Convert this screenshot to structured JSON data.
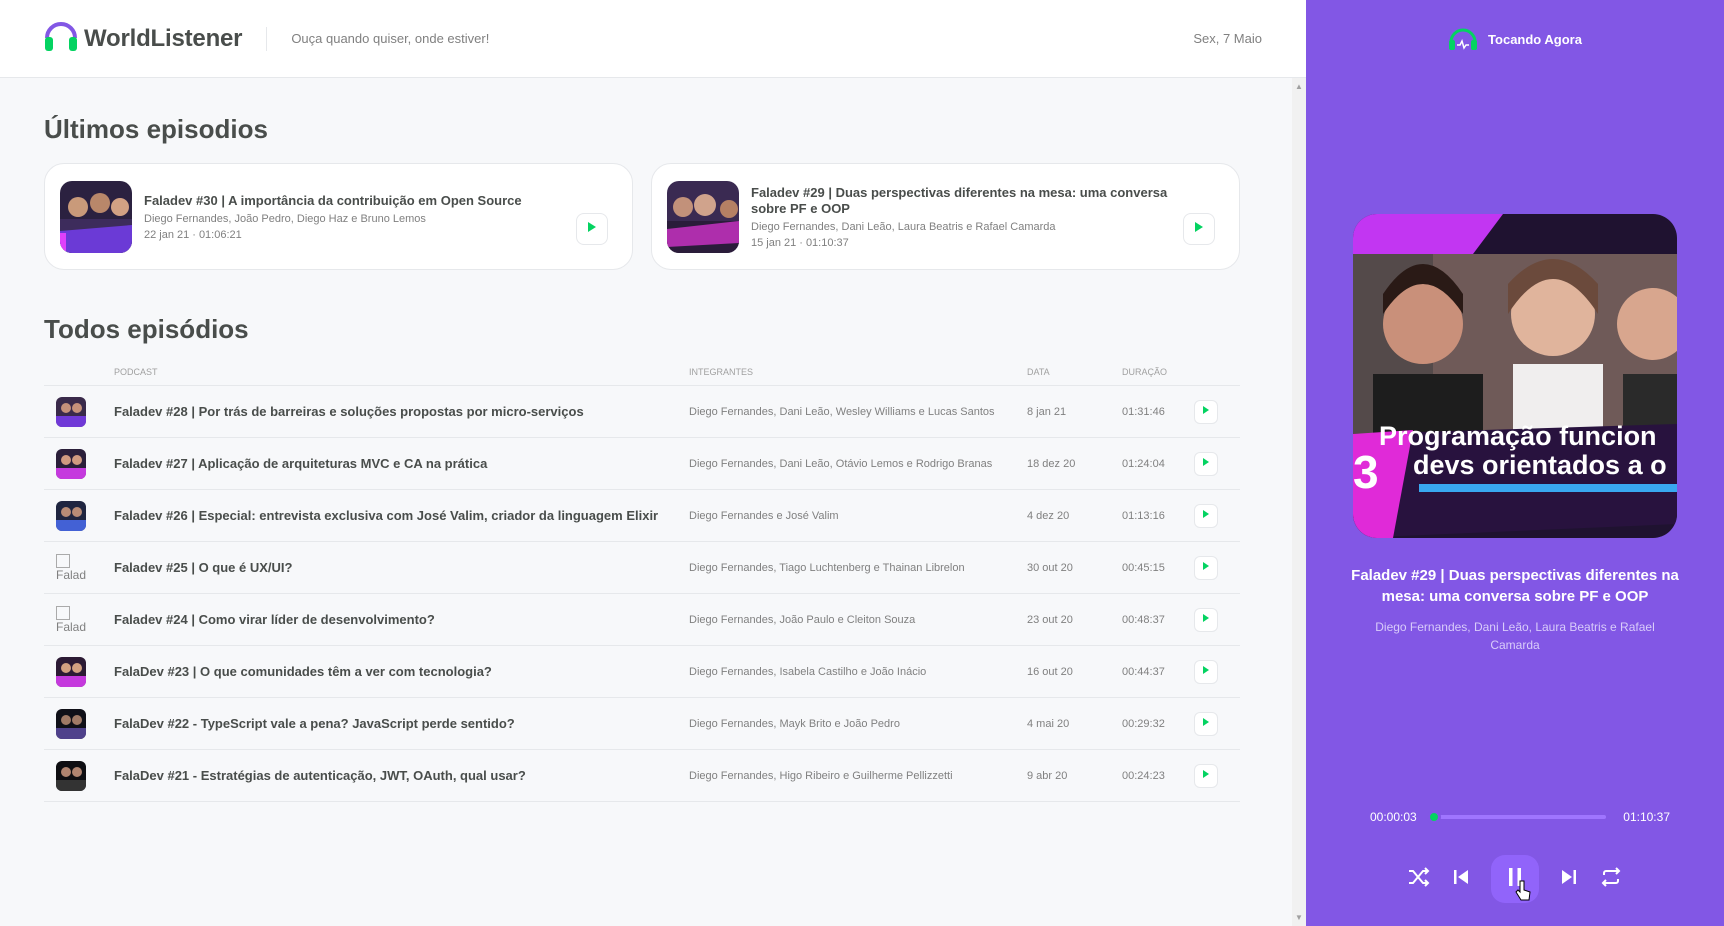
{
  "header": {
    "logo_text": "WorldListener",
    "tagline": "Ouça quando quiser, onde estiver!",
    "date": "Sex, 7 Maio"
  },
  "latest": {
    "title": "Últimos episodios",
    "items": [
      {
        "title": "Faladev #30 | A importância da contribuição em Open Source",
        "members": "Diego Fernandes, João Pedro, Diego Haz e Bruno Lemos",
        "date": "22 jan 21",
        "duration": "01:06:21"
      },
      {
        "title": "Faladev #29 | Duas perspectivas diferentes na mesa: uma conversa sobre PF e OOP",
        "members": "Diego Fernandes, Dani Leão, Laura Beatris e Rafael Camarda",
        "date": "15 jan 21",
        "duration": "01:10:37"
      }
    ]
  },
  "all": {
    "title": "Todos episódios",
    "columns": [
      "",
      "Podcast",
      "Integrantes",
      "Data",
      "Duração",
      ""
    ],
    "rows": [
      {
        "title": "Faladev #28 | Por trás de barreiras e soluções propostas por micro-serviços",
        "members": "Diego Fernandes, Dani Leão, Wesley Williams e Lucas Santos",
        "date": "8 jan 21",
        "duration": "01:31:46",
        "thumb": "ok"
      },
      {
        "title": "Faladev #27 | Aplicação de arquiteturas MVC e CA na prática",
        "members": "Diego Fernandes, Dani Leão, Otávio Lemos e Rodrigo Branas",
        "date": "18 dez 20",
        "duration": "01:24:04",
        "thumb": "ok"
      },
      {
        "title": "Faladev #26 | Especial: entrevista exclusiva com José Valim, criador da linguagem Elixir",
        "members": "Diego Fernandes e José Valim",
        "date": "4 dez 20",
        "duration": "01:13:16",
        "thumb": "ok"
      },
      {
        "title": "Faladev #25 | O que é UX/UI?",
        "members": "Diego Fernandes, Tiago Luchtenberg e Thainan Librelon",
        "date": "30 out 20",
        "duration": "00:45:15",
        "thumb": "broken",
        "alt": "Falad"
      },
      {
        "title": "Faladev #24 | Como virar líder de desenvolvimento?",
        "members": "Diego Fernandes, João Paulo e Cleiton Souza",
        "date": "23 out 20",
        "duration": "00:48:37",
        "thumb": "broken",
        "alt": "Falad"
      },
      {
        "title": "FalaDev #23 | O que comunidades têm a ver com tecnologia?",
        "members": "Diego Fernandes, Isabela Castilho e João Inácio",
        "date": "16 out 20",
        "duration": "00:44:37",
        "thumb": "ok"
      },
      {
        "title": "FalaDev #22 - TypeScript vale a pena? JavaScript perde sentido?",
        "members": "Diego Fernandes, Mayk Brito e João Pedro",
        "date": "4 mai 20",
        "duration": "00:29:32",
        "thumb": "ok"
      },
      {
        "title": "FalaDev #21 - Estratégias de autenticação, JWT, OAuth, qual usar?",
        "members": "Diego Fernandes, Higo Ribeiro e Guilherme Pellizzetti",
        "date": "9 abr 20",
        "duration": "00:24:23",
        "thumb": "ok"
      }
    ]
  },
  "player": {
    "heading": "Tocando Agora",
    "title": "Faladev #29 | Duas perspectivas diferentes na mesa: uma conversa sobre PF e OOP",
    "members": "Diego Fernandes, Dani Leão, Laura Beatris e Rafael Camarda",
    "cover_text_line1": "Programação funcion",
    "cover_text_line2": "devs orientados a o",
    "cover_number": "3",
    "current_time": "00:00:03",
    "total_time": "01:10:37",
    "progress_fraction": 0.0007,
    "state": "playing"
  },
  "colors": {
    "brand_purple": "#8257e5",
    "accent_green": "#04d361",
    "text_dark": "#494d4b",
    "text_muted": "#808080"
  },
  "icons": [
    "headphones-icon",
    "play-icon",
    "shuffle-icon",
    "previous-icon",
    "pause-icon",
    "next-icon",
    "repeat-icon"
  ]
}
